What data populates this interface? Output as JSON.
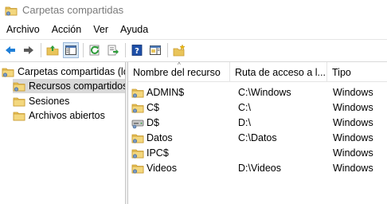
{
  "window": {
    "title": "Carpetas compartidas"
  },
  "menu": [
    "Archivo",
    "Acción",
    "Ver",
    "Ayuda"
  ],
  "toolbar": [
    {
      "icon": "back-arrow-icon",
      "color": "#1f7fd8"
    },
    {
      "icon": "forward-arrow-icon",
      "color": "#5a5a5a"
    },
    {
      "icon": "up-folder-icon"
    },
    {
      "icon": "show-hide-console-tree-icon",
      "active": true
    },
    {
      "icon": "refresh-icon",
      "color": "#2e9c3a"
    },
    {
      "icon": "export-list-icon"
    },
    {
      "icon": "help-icon",
      "color": "#1d4fa8"
    },
    {
      "icon": "show-hide-action-pane-icon"
    },
    {
      "icon": "new-share-icon"
    }
  ],
  "tree": {
    "root": "Carpetas compartidas (lo",
    "children": [
      "Recursos compartidos",
      "Sesiones",
      "Archivos abiertos"
    ],
    "selected_index": 0
  },
  "list": {
    "columns": [
      "Nombre del recurso",
      "Ruta de acceso a l...",
      "Tipo"
    ],
    "rows": [
      {
        "name": "ADMIN$",
        "path": "C:\\Windows",
        "type": "Windows",
        "icon": "shared-folder-icon"
      },
      {
        "name": "C$",
        "path": "C:\\",
        "type": "Windows",
        "icon": "shared-folder-icon"
      },
      {
        "name": "D$",
        "path": "D:\\",
        "type": "Windows",
        "icon": "shared-drive-icon"
      },
      {
        "name": "Datos",
        "path": "C:\\Datos",
        "type": "Windows",
        "icon": "shared-folder-icon"
      },
      {
        "name": "IPC$",
        "path": "",
        "type": "Windows",
        "icon": "shared-folder-icon"
      },
      {
        "name": "Videos",
        "path": "D:\\Videos",
        "type": "Windows",
        "icon": "shared-folder-icon"
      }
    ]
  },
  "colors": {
    "folder_yellow": "#e9c45a",
    "folder_dark": "#c99a2e",
    "selection_gray": "#d9d9d9",
    "title_gray": "#7a7a7a"
  }
}
